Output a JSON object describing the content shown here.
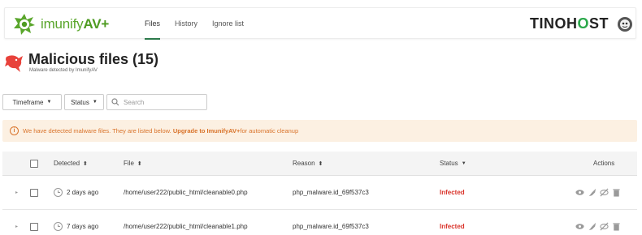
{
  "app": {
    "logo_text": "imunify",
    "logo_suffix": "AV+",
    "brand": {
      "pre": "TINO",
      "mid": "H",
      "o": "O",
      "post": "ST"
    }
  },
  "nav": {
    "items": [
      {
        "label": "Files",
        "active": true
      },
      {
        "label": "History",
        "active": false
      },
      {
        "label": "Ignore list",
        "active": false
      }
    ]
  },
  "page": {
    "title": "Malicious files (15)",
    "subtitle": "Malware detected by ImunifyAV"
  },
  "filters": {
    "timeframe": "Timeframe",
    "status": "Status",
    "search_placeholder": "Search"
  },
  "alert": {
    "text": "We have detected malware files. They are listed below. ",
    "link": "Upgrade to ImunifyAV+",
    "suffix": " for automatic cleanup"
  },
  "table": {
    "headers": {
      "detected": "Detected",
      "file": "File",
      "reason": "Reason",
      "status": "Status",
      "actions": "Actions"
    },
    "rows": [
      {
        "detected": "2 days ago",
        "file": "/home/user222/public_html/cleanable0.php",
        "reason": "php_malware.id_69f537c3",
        "status": "Infected"
      },
      {
        "detected": "7 days ago",
        "file": "/home/user222/public_html/cleanable1.php",
        "reason": "php_malware.id_69f537c3",
        "status": "Infected"
      }
    ]
  },
  "colors": {
    "accent": "#2c7a4b",
    "logo": "#5aa62c",
    "alert_text": "#d9732a",
    "alert_bg": "#fcf0e2",
    "infected": "#d9342b"
  }
}
